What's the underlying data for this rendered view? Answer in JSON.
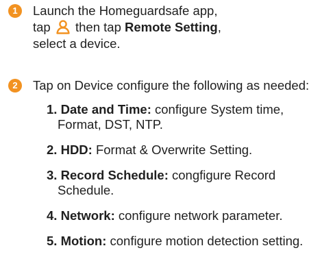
{
  "step1": {
    "number": "1",
    "line1": "Launch the Homeguardsafe app,",
    "line2_pre": "tap",
    "icon": "user-icon",
    "line2_post": "then tap",
    "line2_bold": "Remote Setting",
    "line2_end": ",",
    "line3": "select a device."
  },
  "step2": {
    "number": "2",
    "intro": "Tap on Device configure the following as needed:",
    "items": [
      {
        "num": "1.",
        "label": "Date and Time:",
        "text": "configure System time, Format, DST, NTP."
      },
      {
        "num": "2.",
        "label": "HDD:",
        "text": "Format & Overwrite Setting."
      },
      {
        "num": "3.",
        "label": "Record Schedule:",
        "text": "congfigure Record Schedule."
      },
      {
        "num": "4.",
        "label": "Network:",
        "text": "configure network parameter."
      },
      {
        "num": "5.",
        "label": "Motion:",
        "text": "configure motion detection setting."
      }
    ]
  },
  "colors": {
    "accent": "#f29221",
    "text": "#1f1f1f"
  }
}
